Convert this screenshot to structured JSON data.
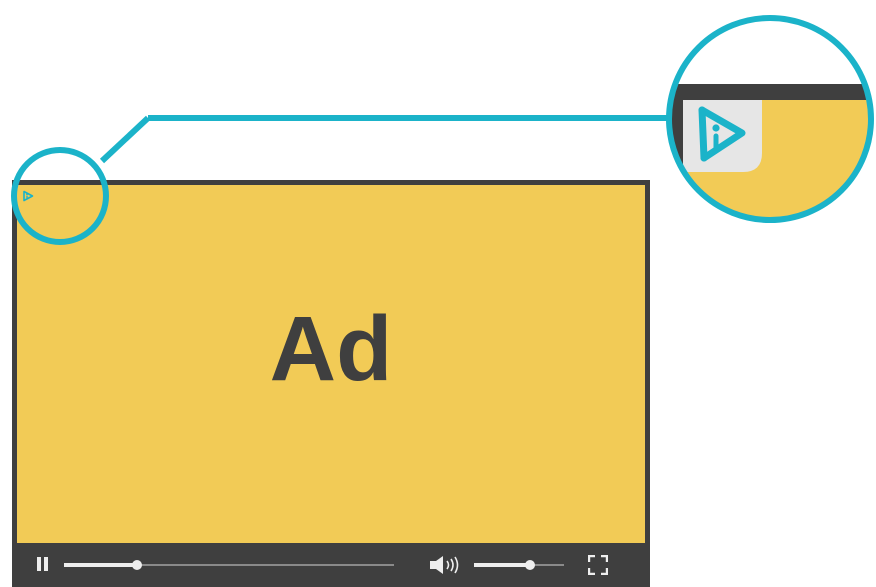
{
  "ad": {
    "label": "Ad"
  },
  "player": {
    "state": "playing",
    "progress_fraction": 0.22,
    "volume_fraction": 0.62
  },
  "icons": {
    "pause": "pause-icon",
    "volume": "volume-icon",
    "fullscreen": "fullscreen-icon",
    "adchoices": "adchoices-info-icon"
  },
  "colors": {
    "ad_background": "#f2cb56",
    "player_frame": "#3f3f3f",
    "callout": "#1bb3c9",
    "badge_background": "#e6e6e6",
    "controls": "#eeeeee"
  }
}
